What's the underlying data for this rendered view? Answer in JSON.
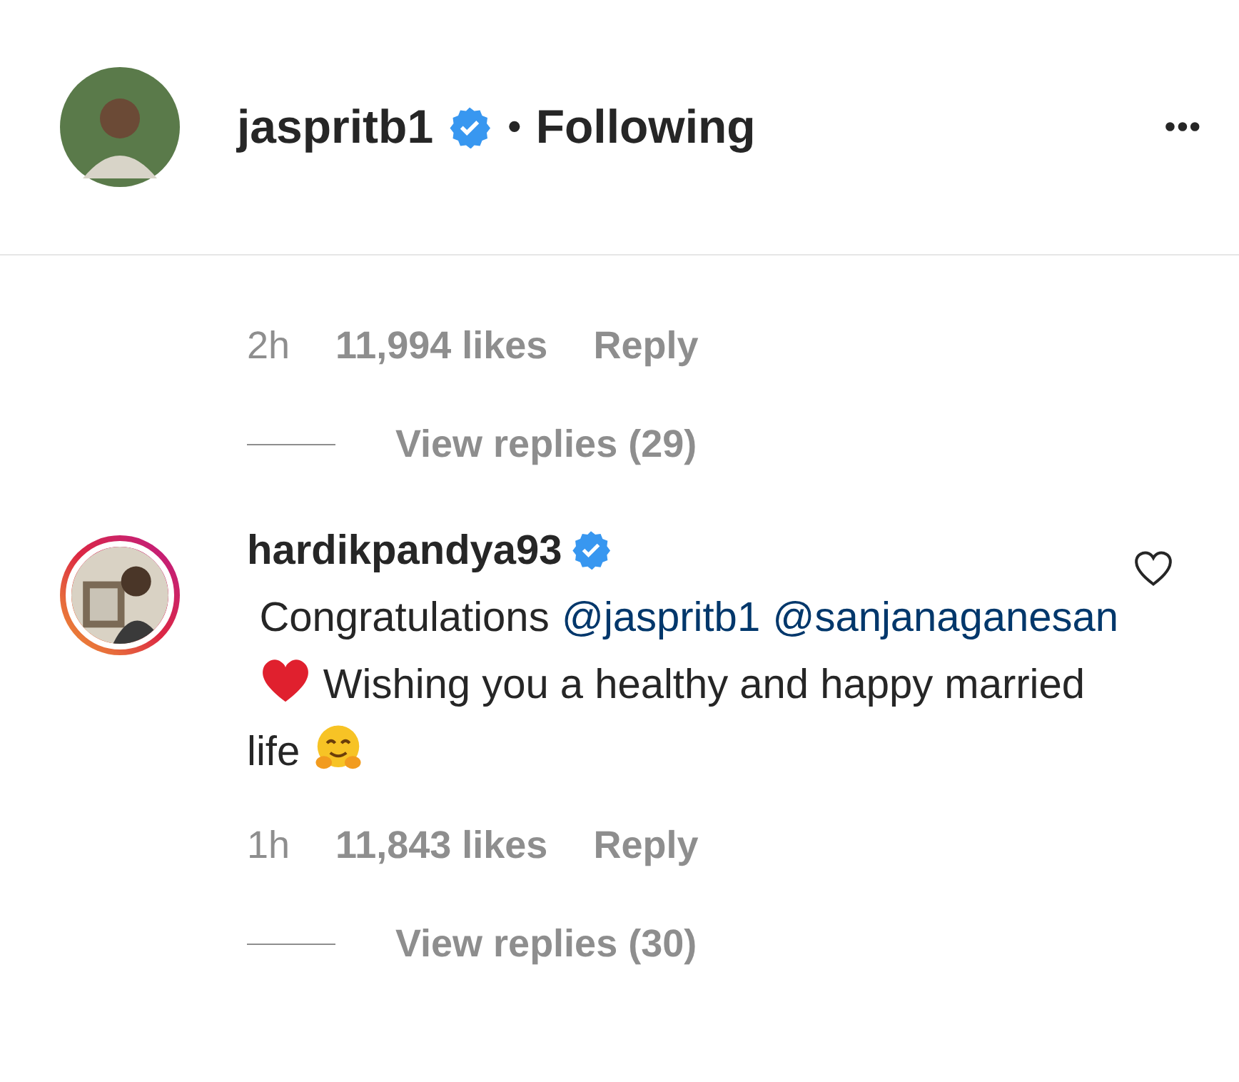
{
  "header": {
    "username": "jaspritb1",
    "verified": true,
    "status": "Following",
    "separator": "•",
    "menu": "•••"
  },
  "comments": [
    {
      "meta": {
        "time": "2h",
        "likes": "11,994 likes",
        "reply": "Reply"
      },
      "replies": {
        "label": "View replies (29)"
      }
    },
    {
      "avatar": {
        "story_ring": true
      },
      "username": "hardikpandya93",
      "verified": true,
      "liked": false,
      "parts": [
        {
          "kind": "text",
          "text": "Congratulations"
        },
        {
          "kind": "mention",
          "text": "@jaspritb1"
        },
        {
          "kind": "mention",
          "text": "@sanjanaganesan"
        },
        {
          "kind": "heart"
        },
        {
          "kind": "text",
          "text": "Wishing you a healthy and happy married life"
        },
        {
          "kind": "hug"
        }
      ],
      "meta": {
        "time": "1h",
        "likes": "11,843 likes",
        "reply": "Reply"
      },
      "replies": {
        "label": "View replies (30)"
      }
    }
  ]
}
